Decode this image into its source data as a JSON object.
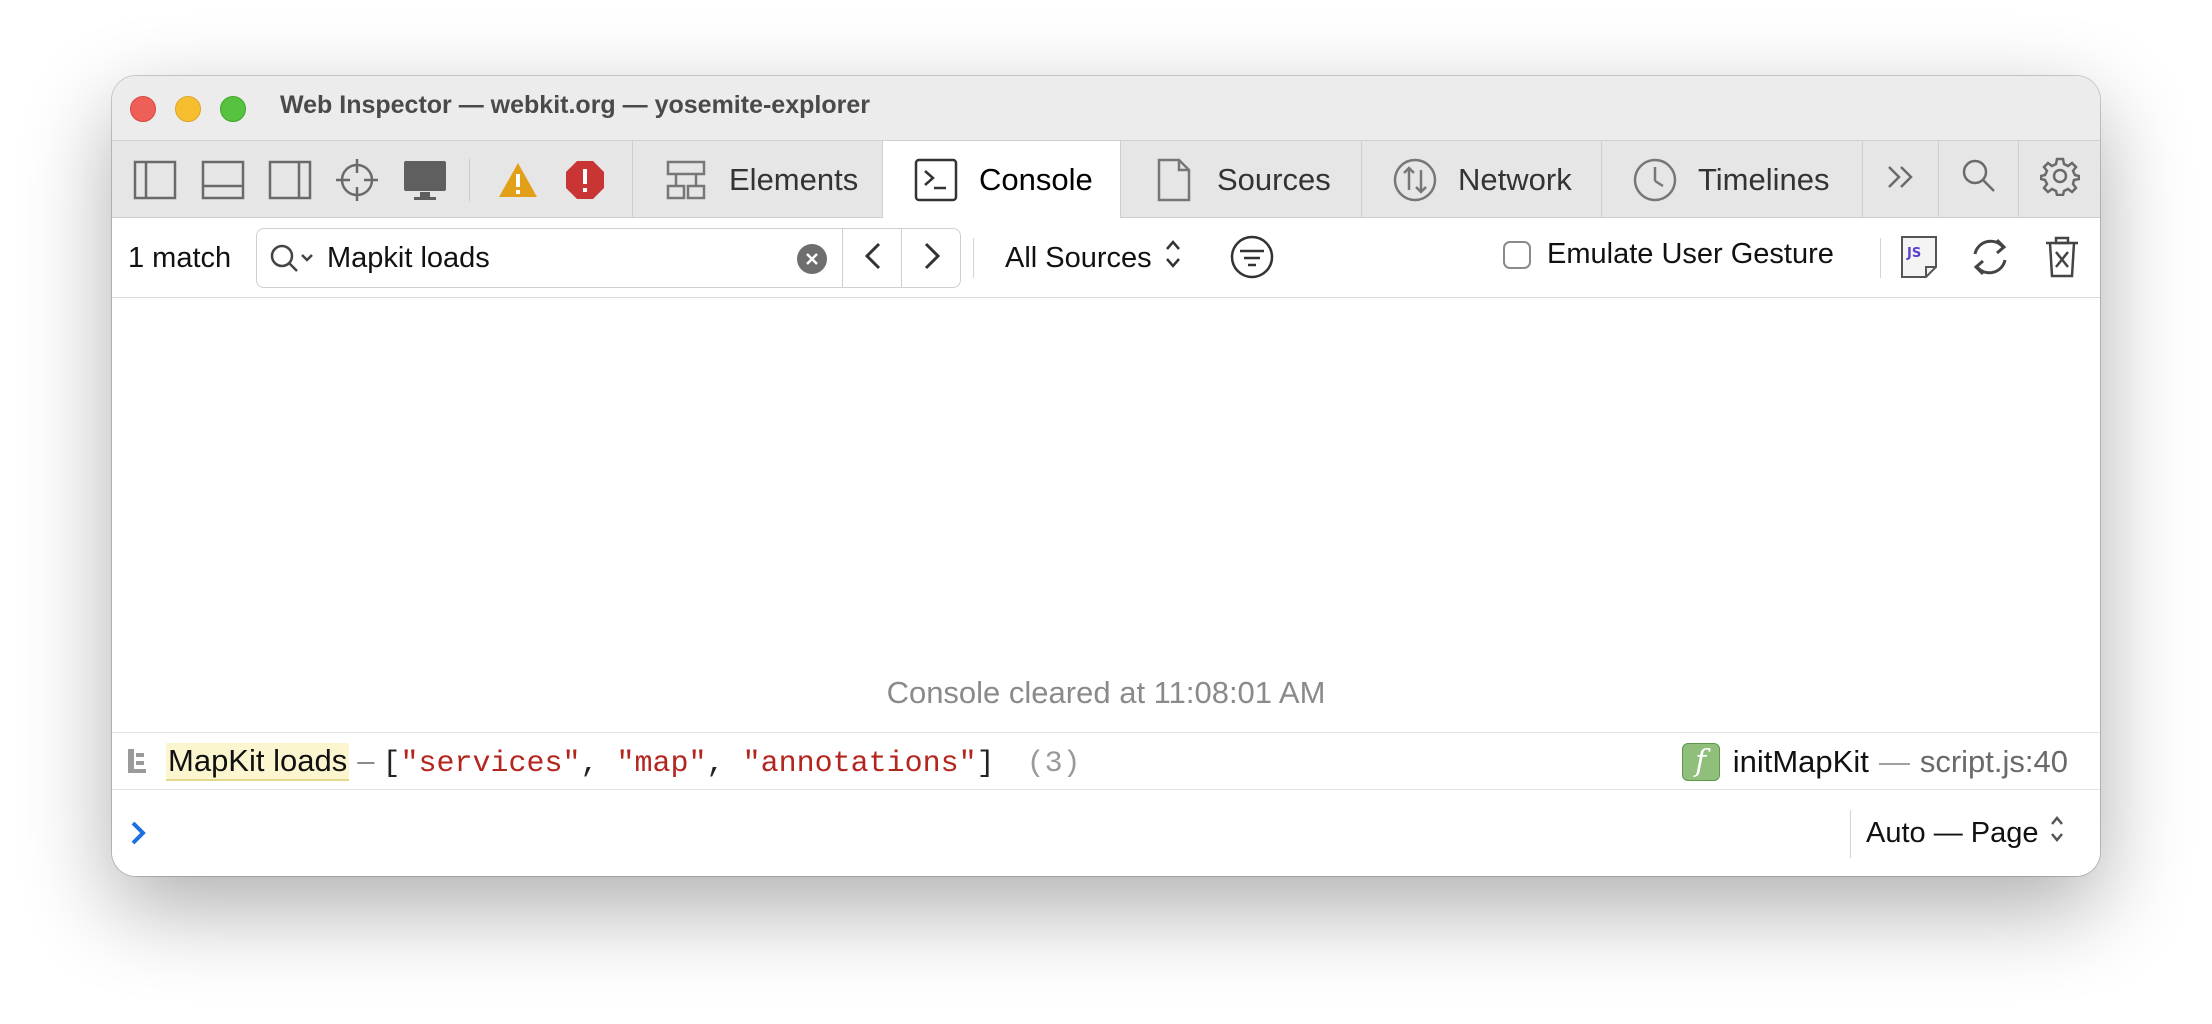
{
  "window": {
    "title": "Web Inspector — webkit.org — yosemite-explorer"
  },
  "toolbar": {
    "layout_icons": [
      "sidebar-left-icon",
      "dock-bottom-icon",
      "sidebar-right-icon",
      "crosshair-icon",
      "display-icon"
    ],
    "warning_icon": "warning-icon",
    "error_icon": "error-icon",
    "tabs": [
      {
        "label": "Elements",
        "icon": "elements-icon",
        "active": false
      },
      {
        "label": "Console",
        "icon": "console-icon",
        "active": true
      },
      {
        "label": "Sources",
        "icon": "sources-icon",
        "active": false
      },
      {
        "label": "Network",
        "icon": "network-icon",
        "active": false
      },
      {
        "label": "Timelines",
        "icon": "timelines-icon",
        "active": false
      }
    ],
    "overflow_icon": "chevron-double-right-icon",
    "search_icon": "search-icon",
    "settings_icon": "gear-icon"
  },
  "filter": {
    "match_count": "1 match",
    "search_value": "Mapkit loads",
    "search_placeholder": "",
    "source_select": "All Sources",
    "emulate_label": "Emulate User Gesture",
    "emulate_checked": false
  },
  "console": {
    "cleared_message": "Console cleared at 11:08:01 AM",
    "log": {
      "text": "MapKit loads",
      "separator": "–",
      "array_open": "[",
      "array_close": "]",
      "items": [
        "\"services\"",
        "\"map\"",
        "\"annotations\""
      ],
      "count": "(3)",
      "function_badge": "f",
      "function_name": "initMapKit",
      "location_separator": "—",
      "location": "script.js:40"
    },
    "prompt_value": "",
    "context_select": "Auto — Page"
  },
  "colors": {
    "accent": "#1f6fe5",
    "string": "#b3261e",
    "warning": "#e2a018",
    "error": "#c93434",
    "highlight": "#fbf6cf"
  }
}
